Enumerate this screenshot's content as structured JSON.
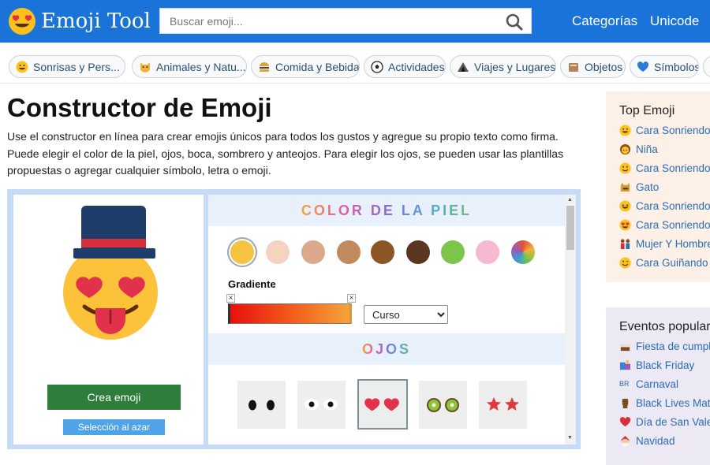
{
  "header": {
    "logo_text": "Emoji Tool",
    "search_placeholder": "Buscar emoji...",
    "nav": [
      "Categorías",
      "Unicode"
    ],
    "bg_color": "#1a73d9"
  },
  "categories": [
    {
      "label": "Sonrisas y Pers...",
      "icon": "grinning-face-icon"
    },
    {
      "label": "Animales y Natu...",
      "icon": "cat-face-icon"
    },
    {
      "label": "Comida y Bebida",
      "icon": "burger-icon"
    },
    {
      "label": "Actividades",
      "icon": "soccer-ball-icon"
    },
    {
      "label": "Viajes y Lugares",
      "icon": "tent-icon"
    },
    {
      "label": "Objetos",
      "icon": "box-icon"
    },
    {
      "label": "Símbolos",
      "icon": "heart-icon"
    }
  ],
  "main": {
    "title": "Constructor de Emoji",
    "intro": "Use el constructor en línea para crear emojis únicos para todos los gustos y agregue su propio texto como firma. Puede elegir el color de la piel, ojos, boca, sombrero y anteojos. Para elegir los ojos, se pueden usar las plantillas propuestas o agregar cualquier símbolo, letra o emoji."
  },
  "builder": {
    "create_label": "Crea emoji",
    "random_label": "Selección al azar",
    "skin_heading": "COLOR DE LA PIEL",
    "skin_colors": [
      "#f5c242",
      "#f6d3c0",
      "#d9a98a",
      "#c08a5e",
      "#8b5526",
      "#5a3520",
      "#7cc44a",
      "#f7b9cf",
      "multicolor"
    ],
    "gradient_label": "Gradiente",
    "gradient_colors": [
      "#e61010",
      "#f5a33a"
    ],
    "gradient_mode": "Curso",
    "eyes_heading": "OJOS",
    "eye_options": [
      "black-dots-eyes",
      "white-eyes",
      "heart-eyes",
      "kiwi-eyes",
      "star-eyes"
    ],
    "selected_eyes": "heart-eyes"
  },
  "sidebar": {
    "top_title": "Top Emoji",
    "top_items": [
      {
        "label": "Cara Sonriendo",
        "icon": "grinning-face-icon"
      },
      {
        "label": "Niña",
        "icon": "girl-icon"
      },
      {
        "label": "Cara Sonriendo",
        "icon": "smiling-face-icon"
      },
      {
        "label": "Gato",
        "icon": "cat-icon"
      },
      {
        "label": "Cara Sonriendo",
        "icon": "smiling-squint-icon"
      },
      {
        "label": "Cara Sonriendo",
        "icon": "heart-eyes-face-icon"
      },
      {
        "label": "Mujer Y Hombre",
        "icon": "couple-icon"
      },
      {
        "label": "Cara Guiñando",
        "icon": "winking-face-icon"
      }
    ],
    "events_title": "Eventos popular",
    "event_items": [
      {
        "label": "Fiesta de cumple",
        "icon": "cake-icon"
      },
      {
        "label": "Black Friday",
        "icon": "shopping-icon"
      },
      {
        "label": "Carnaval",
        "icon": "br-flag-icon",
        "icon_text": "BR"
      },
      {
        "label": "Black Lives Matte",
        "icon": "raised-fist-icon"
      },
      {
        "label": "Día de San Vale",
        "icon": "heart-icon"
      },
      {
        "label": "Navidad",
        "icon": "santa-icon"
      }
    ]
  }
}
